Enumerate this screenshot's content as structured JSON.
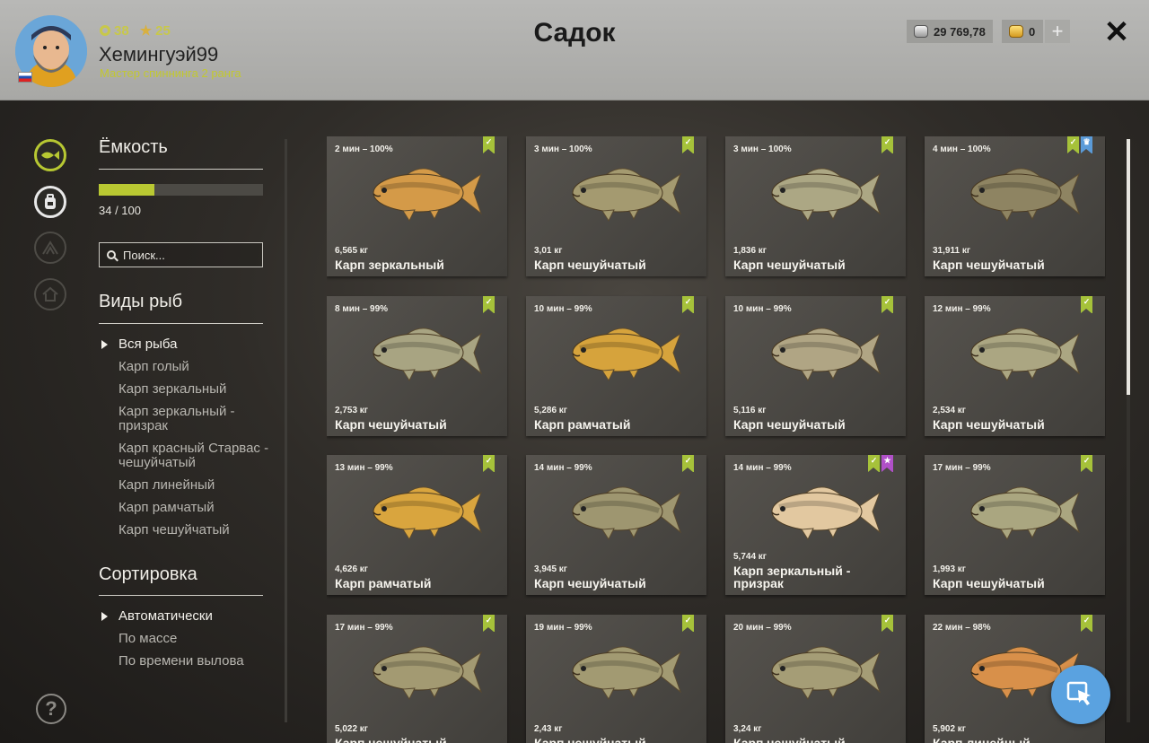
{
  "header": {
    "title": "Садок",
    "player_name": "Хемингуэй99",
    "player_rank": "Мастер спиннинга 2 ранга",
    "level": "38",
    "rating": "25",
    "silver": "29 769,78",
    "gold": "0",
    "add_label": "+",
    "close_label": "✕"
  },
  "left": {
    "capacity_title": "Ёмкость",
    "capacity_text": "34 / 100",
    "capacity_fraction": 0.34,
    "search_placeholder": "Поиск...",
    "species_title": "Виды рыб",
    "species": [
      "Вся рыба",
      "Карп голый",
      "Карп зеркальный",
      "Карп зеркальный - призрак",
      "Карп красный Старвас - чешуйчатый",
      "Карп линейный",
      "Карп рамчатый",
      "Карп чешуйчатый"
    ],
    "sort_title": "Сортировка",
    "sort": [
      "Автоматически",
      "По массе",
      "По времени вылова"
    ],
    "help_label": "?"
  },
  "fish": [
    {
      "time": "2 мин – 100%",
      "weight": "6,565 кг",
      "name": "Карп зеркальный",
      "color": "#d49a48",
      "badges": [
        "check"
      ]
    },
    {
      "time": "3 мин – 100%",
      "weight": "3,01 кг",
      "name": "Карп чешуйчатый",
      "color": "#a49a70",
      "badges": [
        "check"
      ]
    },
    {
      "time": "3 мин – 100%",
      "weight": "1,836 кг",
      "name": "Карп чешуйчатый",
      "color": "#aca784",
      "badges": [
        "check"
      ]
    },
    {
      "time": "4 мин – 100%",
      "weight": "31,911 кг",
      "name": "Карп чешуйчатый",
      "color": "#8e8462",
      "badges": [
        "check",
        "crown"
      ]
    },
    {
      "time": "8 мин – 99%",
      "weight": "2,753 кг",
      "name": "Карп чешуйчатый",
      "color": "#a8a482",
      "badges": [
        "check"
      ]
    },
    {
      "time": "10 мин – 99%",
      "weight": "5,286 кг",
      "name": "Карп рамчатый",
      "color": "#d6a33c",
      "badges": [
        "check"
      ]
    },
    {
      "time": "10 мин – 99%",
      "weight": "5,116 кг",
      "name": "Карп чешуйчатый",
      "color": "#b0a584",
      "badges": [
        "check"
      ]
    },
    {
      "time": "12 мин – 99%",
      "weight": "2,534 кг",
      "name": "Карп чешуйчатый",
      "color": "#aba682",
      "badges": [
        "check"
      ]
    },
    {
      "time": "13 мин – 99%",
      "weight": "4,626 кг",
      "name": "Карп рамчатый",
      "color": "#d9a53e",
      "badges": [
        "check"
      ]
    },
    {
      "time": "14 мин – 99%",
      "weight": "3,945 кг",
      "name": "Карп чешуйчатый",
      "color": "#9e9670",
      "badges": [
        "check"
      ]
    },
    {
      "time": "14 мин – 99%",
      "weight": "5,744 кг",
      "name": "Карп зеркальный - призрак",
      "color": "#e2c8a0",
      "badges": [
        "check",
        "star"
      ]
    },
    {
      "time": "17 мин – 99%",
      "weight": "1,993 кг",
      "name": "Карп чешуйчатый",
      "color": "#aaa680",
      "badges": [
        "check"
      ]
    },
    {
      "time": "17 мин – 99%",
      "weight": "5,022 кг",
      "name": "Карп чешуйчатый",
      "color": "#a39a72",
      "badges": [
        "check"
      ]
    },
    {
      "time": "19 мин – 99%",
      "weight": "2,43 кг",
      "name": "Карп чешуйчатый",
      "color": "#a29a72",
      "badges": [
        "check"
      ]
    },
    {
      "time": "20 мин – 99%",
      "weight": "3,24 кг",
      "name": "Карп чешуйчатый",
      "color": "#a59d76",
      "badges": [
        "check"
      ]
    },
    {
      "time": "22 мин – 98%",
      "weight": "5,902 кг",
      "name": "Карп линейный",
      "color": "#d8904a",
      "badges": [
        "check"
      ]
    }
  ]
}
